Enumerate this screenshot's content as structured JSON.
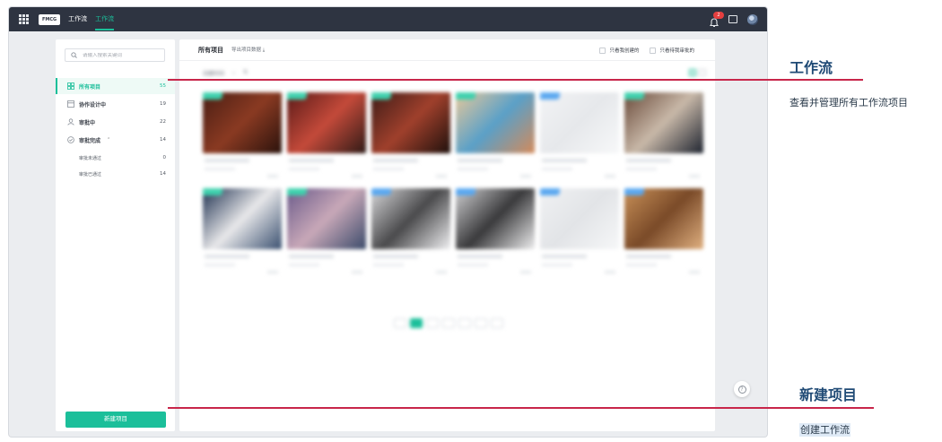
{
  "topbar": {
    "logo": "FMCG",
    "tabs": [
      {
        "label": "工作流"
      },
      {
        "label": "工作流"
      }
    ],
    "notification_badge": "2",
    "brand_color": "#1bbf9a",
    "bar_color": "#2e3441"
  },
  "sidebar": {
    "search_placeholder": "请输入搜索关键词",
    "items": [
      {
        "label": "所有项目",
        "count": "55",
        "icon": "grid-icon"
      },
      {
        "label": "协作设计中",
        "count": "19",
        "icon": "document-icon"
      },
      {
        "label": "审批中",
        "count": "22",
        "icon": "user-icon"
      },
      {
        "label": "审批完成",
        "count": "14",
        "icon": "check-circle-icon"
      }
    ],
    "sub_items": [
      {
        "label": "审批未通过",
        "count": "0"
      },
      {
        "label": "审批已通过",
        "count": "14"
      }
    ],
    "new_button": "新建项目"
  },
  "main": {
    "title": "所有项目",
    "export_label": "导出项目数据",
    "filters": [
      "只看我创建的",
      "只看待我审批的"
    ],
    "sort_label": "创建时间",
    "cards": [
      {
        "tag_color": "#3dd1ad"
      },
      {
        "tag_color": "#3dd1ad"
      },
      {
        "tag_color": "#3dd1ad"
      },
      {
        "tag_color": "#3dd1ad"
      },
      {
        "tag_color": "#5aa8f0"
      },
      {
        "tag_color": "#3dd1ad"
      },
      {
        "tag_color": "#3dd1ad"
      },
      {
        "tag_color": "#3dd1ad"
      },
      {
        "tag_color": "#5aa8f0"
      },
      {
        "tag_color": "#5aa8f0"
      },
      {
        "tag_color": "#5aa8f0"
      },
      {
        "tag_color": "#5aa8f0"
      }
    ]
  },
  "annotations": {
    "workflow": {
      "title": "工作流",
      "desc": "查看并管理所有工作流项目"
    },
    "new_project": {
      "title": "新建项目",
      "desc": "创建工作流"
    },
    "line_color": "#c8264a"
  }
}
